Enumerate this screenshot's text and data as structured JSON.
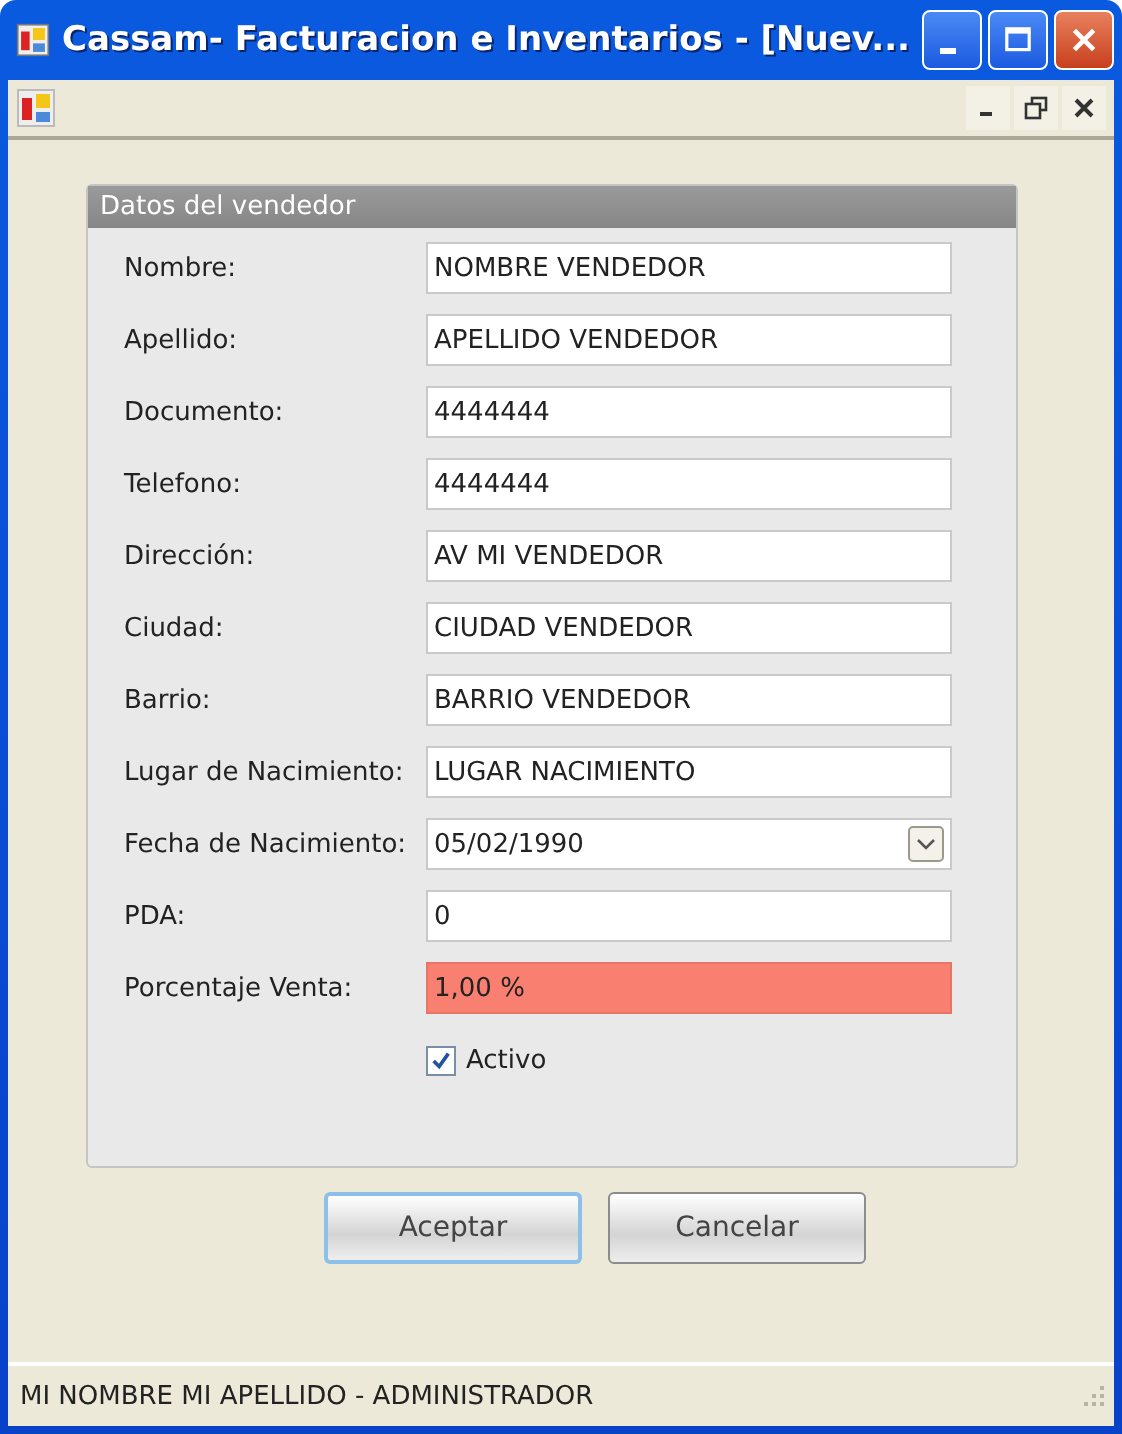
{
  "window": {
    "title": "Cassam- Facturacion e Inventarios - [Nuev..."
  },
  "group": {
    "title": "Datos del vendedor",
    "fields": [
      {
        "label": "Nombre:",
        "value": "NOMBRE VENDEDOR",
        "kind": "text",
        "highlighted": false
      },
      {
        "label": "Apellido:",
        "value": "APELLIDO VENDEDOR",
        "kind": "text",
        "highlighted": false
      },
      {
        "label": "Documento:",
        "value": "4444444",
        "kind": "text",
        "highlighted": false
      },
      {
        "label": "Telefono:",
        "value": "4444444",
        "kind": "text",
        "highlighted": false
      },
      {
        "label": "Dirección:",
        "value": "AV MI VENDEDOR",
        "kind": "text",
        "highlighted": false
      },
      {
        "label": "Ciudad:",
        "value": "CIUDAD VENDEDOR",
        "kind": "text",
        "highlighted": false
      },
      {
        "label": "Barrio:",
        "value": "BARRIO VENDEDOR",
        "kind": "text",
        "highlighted": false
      },
      {
        "label": "Lugar de Nacimiento:",
        "value": "LUGAR NACIMIENTO",
        "kind": "text",
        "highlighted": false
      },
      {
        "label": "Fecha de Nacimiento:",
        "value": "05/02/1990",
        "kind": "date",
        "highlighted": false
      },
      {
        "label": "PDA:",
        "value": "0",
        "kind": "text",
        "highlighted": false
      },
      {
        "label": "Porcentaje Venta:",
        "value": "1,00 %",
        "kind": "text",
        "highlighted": true
      }
    ],
    "checkbox": {
      "label": "Activo",
      "checked": true
    }
  },
  "buttons": [
    {
      "label": "Aceptar",
      "focused": true
    },
    {
      "label": "Cancelar",
      "focused": false
    }
  ],
  "status_bar": "MI NOMBRE MI APELLIDO - ADMINISTRADOR"
}
